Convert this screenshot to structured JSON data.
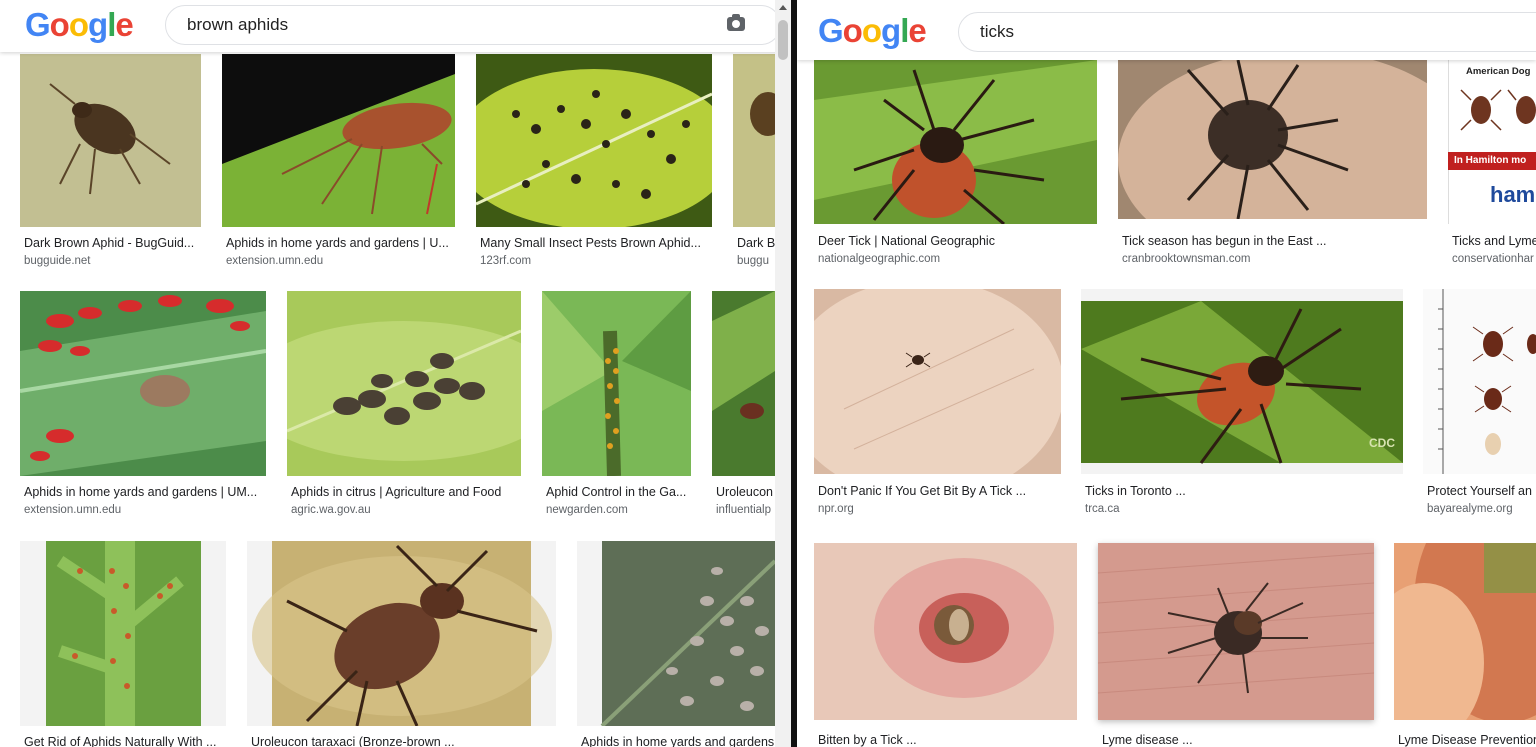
{
  "left": {
    "search_query": "brown aphids",
    "logo": "Google",
    "results": [
      {
        "title": "Dark Brown Aphid - BugGuid...",
        "domain": "bugguide.net"
      },
      {
        "title": "Aphids in home yards and gardens | U...",
        "domain": "extension.umn.edu"
      },
      {
        "title": "Many Small Insect Pests Brown Aphid...",
        "domain": "123rf.com"
      },
      {
        "title": "Dark B",
        "domain": "buggu"
      },
      {
        "title": "Aphids in home yards and gardens | UM...",
        "domain": "extension.umn.edu"
      },
      {
        "title": "Aphids in citrus | Agriculture and Food",
        "domain": "agric.wa.gov.au"
      },
      {
        "title": "Aphid Control in the Ga...",
        "domain": "newgarden.com"
      },
      {
        "title": "Uroleucon",
        "domain": "influentialp"
      },
      {
        "title": "Get Rid of Aphids Naturally With ...",
        "domain": ""
      },
      {
        "title": "Uroleucon taraxaci (Bronze-brown ...",
        "domain": ""
      },
      {
        "title": "Aphids in home yards and gardens",
        "domain": ""
      }
    ]
  },
  "right": {
    "search_query": "ticks",
    "logo": "Google",
    "results": [
      {
        "title": "Deer Tick | National Geographic",
        "domain": "nationalgeographic.com"
      },
      {
        "title": "Tick season has begun in the East ...",
        "domain": "cranbrooktownsman.com"
      },
      {
        "title": "Ticks and Lyme",
        "domain": "conservationhar"
      },
      {
        "title": "Don't Panic If You Get Bit By A Tick ...",
        "domain": "npr.org"
      },
      {
        "title": "Ticks in Toronto ...",
        "domain": "trca.ca"
      },
      {
        "title": "Protect Yourself an",
        "domain": "bayarealyme.org"
      },
      {
        "title": "Bitten by a Tick ...",
        "domain": ""
      },
      {
        "title": "Lyme disease ...",
        "domain": ""
      },
      {
        "title": "Lyme Disease Prevention",
        "domain": ""
      }
    ],
    "image_text": {
      "american_dog": "American Dog",
      "in_hamilton": "In Hamilton mo",
      "ham": "ham",
      "cdc": "CDC"
    }
  }
}
